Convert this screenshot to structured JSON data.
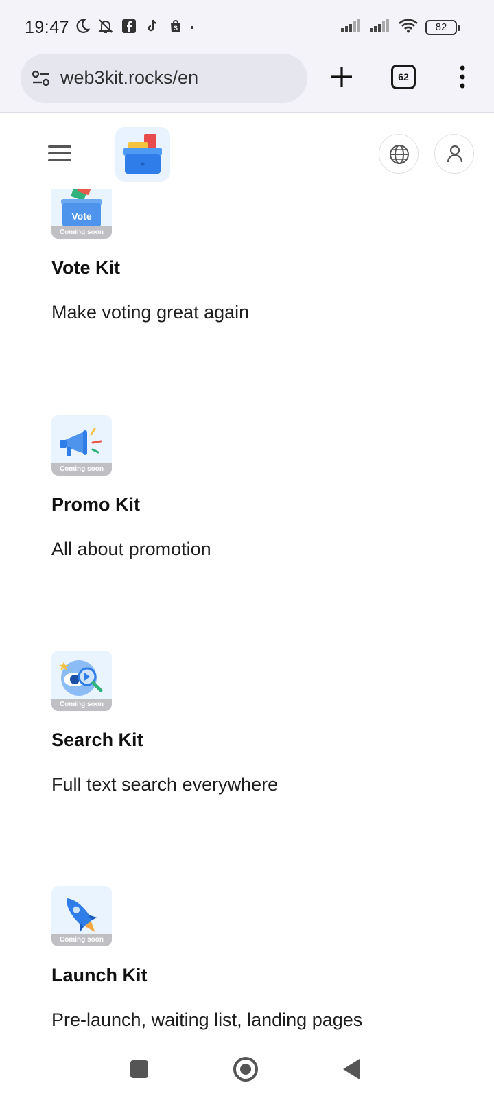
{
  "status_bar": {
    "time": "19:47",
    "battery": "82",
    "icons": [
      "moon-icon",
      "bell-off-icon",
      "facebook-page-icon",
      "tiktok-icon",
      "shopify-icon",
      "signal-icon",
      "signal-icon",
      "wifi-icon",
      "battery-icon"
    ]
  },
  "browser": {
    "url": "web3kit.rocks/en",
    "tab_count": "62"
  },
  "kits": [
    {
      "title": "Vote Kit",
      "description": "Make voting great again",
      "badge": "Coming soon",
      "thumb_label": "Vote"
    },
    {
      "title": "Promo Kit",
      "description": "All about promotion",
      "badge": "Coming soon"
    },
    {
      "title": "Search Kit",
      "description": "Full text search everywhere",
      "badge": "Coming soon"
    },
    {
      "title": "Launch Kit",
      "description": "Pre-launch, waiting list, landing pages",
      "badge": "Coming soon"
    }
  ],
  "colors": {
    "accent_blue": "#2f7de8",
    "chrome_bg": "#f3f3f9",
    "badge_gray": "#bfbfc4"
  }
}
